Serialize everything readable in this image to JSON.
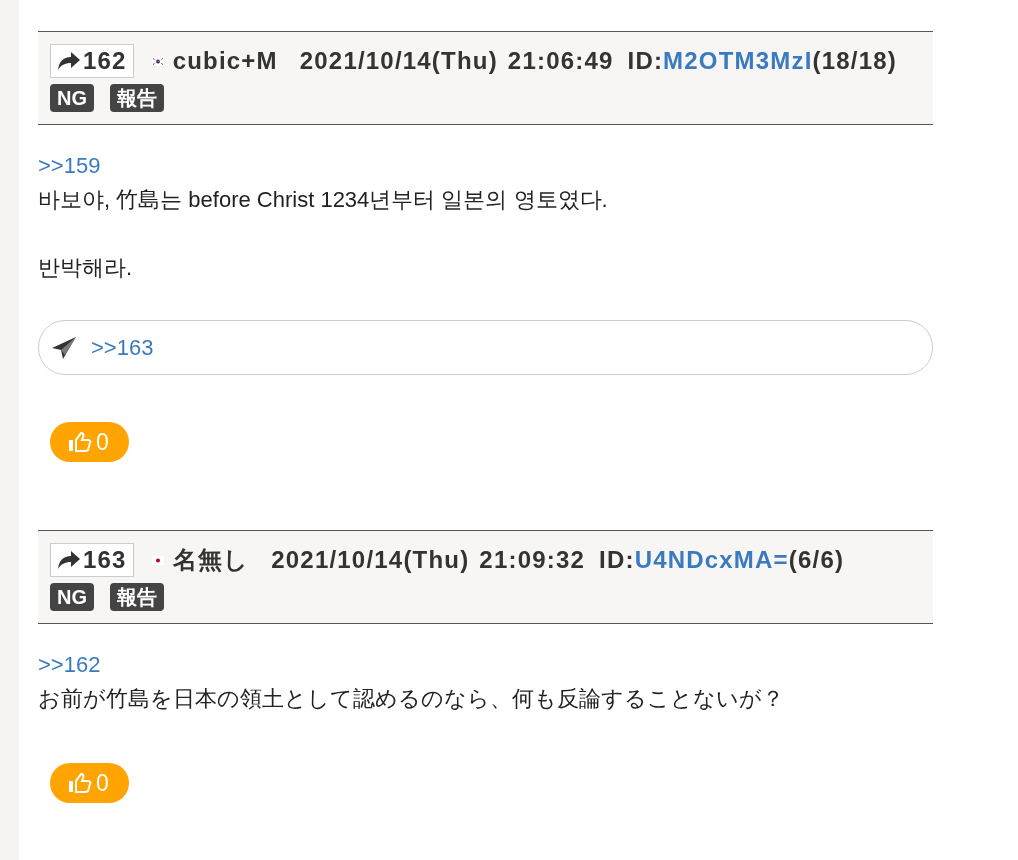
{
  "posts": [
    {
      "number": "162",
      "flag": {
        "kind": "kr"
      },
      "name": "cubic+M",
      "date": "2021/10/14(Thu)",
      "time": "21:06:49",
      "id_label": "ID:",
      "id": "M2OTM3MzI",
      "id_count": "(18/18)",
      "tags": [
        "NG",
        "報告"
      ],
      "body": [
        {
          "kind": "anchor",
          "text": ">>159"
        },
        {
          "kind": "text",
          "text": "바보야, 竹島는 before Christ 1234년부터 일본의 영토였다."
        },
        {
          "kind": "blank"
        },
        {
          "kind": "text",
          "text": "반박해라."
        }
      ],
      "reply_link": ">>163",
      "likes": "0"
    },
    {
      "number": "163",
      "flag": {
        "kind": "jp"
      },
      "name": "名無し",
      "date": "2021/10/14(Thu)",
      "time": "21:09:32",
      "id_label": "ID:",
      "id": "U4NDcxMA=",
      "id_count": "(6/6)",
      "tags": [
        "NG",
        "報告"
      ],
      "body": [
        {
          "kind": "anchor",
          "text": ">>162"
        },
        {
          "kind": "text",
          "text": "お前が竹島を日本の領土として認めるのなら、何も反論することないが？"
        }
      ],
      "likes": "0"
    }
  ]
}
